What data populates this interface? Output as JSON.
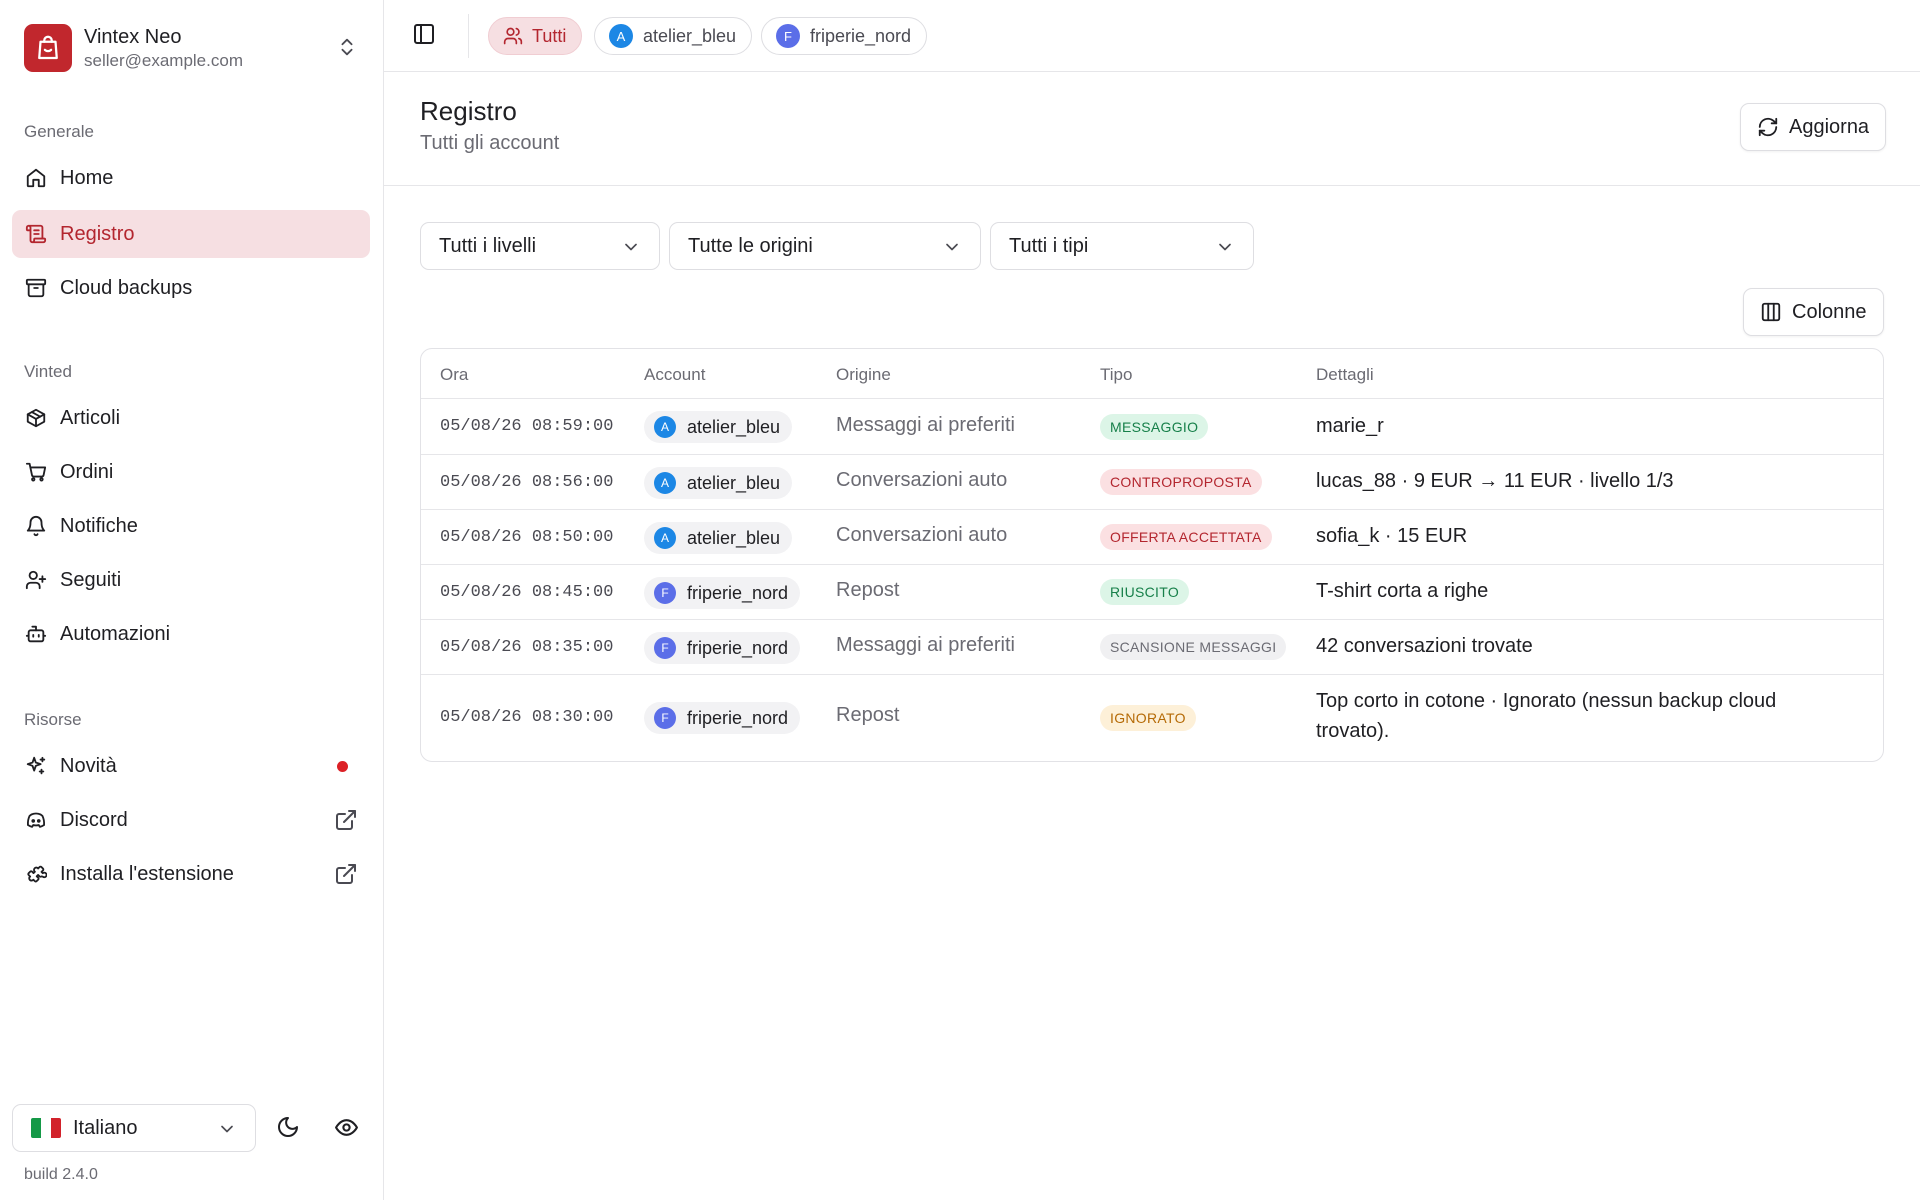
{
  "app": {
    "name": "Vintex Neo",
    "email": "seller@example.com",
    "build": "build 2.4.0"
  },
  "sidebar": {
    "sections": {
      "general": "Generale",
      "vinted": "Vinted",
      "resources": "Risorse"
    },
    "items": {
      "home": "Home",
      "registro": "Registro",
      "cloud_backups": "Cloud backups",
      "articoli": "Articoli",
      "ordini": "Ordini",
      "notifiche": "Notifiche",
      "seguiti": "Seguiti",
      "automazioni": "Automazioni",
      "novita": "Novità",
      "discord": "Discord",
      "estensione": "Installa l'estensione"
    },
    "active_item": "registro",
    "language": "Italiano"
  },
  "topbar": {
    "chips": [
      {
        "label": "Tutti",
        "active": true
      },
      {
        "label": "atelier_bleu",
        "avatar": "A",
        "active": false
      },
      {
        "label": "friperie_nord",
        "avatar": "F",
        "active": false
      }
    ]
  },
  "page": {
    "title": "Registro",
    "subtitle": "Tutti gli account",
    "refresh_label": "Aggiorna",
    "columns_label": "Colonne"
  },
  "filters": {
    "levels": "Tutti i livelli",
    "origins": "Tutte le origini",
    "types": "Tutti i tipi"
  },
  "table": {
    "headers": {
      "time": "Ora",
      "account": "Account",
      "origin": "Origine",
      "type": "Tipo",
      "details": "Dettagli"
    },
    "rows": [
      {
        "time": "05/08/26 08:59:00",
        "avatar": "A",
        "account": "atelier_bleu",
        "origin": "Messaggi ai preferiti",
        "type": "MESSAGGIO",
        "details": "marie_r"
      },
      {
        "time": "05/08/26 08:56:00",
        "avatar": "A",
        "account": "atelier_bleu",
        "origin": "Conversazioni auto",
        "type": "CONTROPROPOSTA",
        "details": "lucas_88 · 9 EUR → 11 EUR · livello 1/3"
      },
      {
        "time": "05/08/26 08:50:00",
        "avatar": "A",
        "account": "atelier_bleu",
        "origin": "Conversazioni auto",
        "type": "OFFERTA ACCETTATA",
        "details": "sofia_k · 15 EUR"
      },
      {
        "time": "05/08/26 08:45:00",
        "avatar": "F",
        "account": "friperie_nord",
        "origin": "Repost",
        "type": "RIUSCITO",
        "details": "T-shirt corta a righe"
      },
      {
        "time": "05/08/26 08:35:00",
        "avatar": "F",
        "account": "friperie_nord",
        "origin": "Messaggi ai preferiti",
        "type": "SCANSIONE MESSAGGI",
        "details": "42 conversazioni trovate"
      },
      {
        "time": "05/08/26 08:30:00",
        "avatar": "F",
        "account": "friperie_nord",
        "origin": "Repost",
        "type": "IGNORATO",
        "details": "Top corto in cotone · Ignorato (nessun backup cloud trovato)."
      }
    ]
  },
  "colors": {
    "brand": "#c1272d",
    "active_bg": "#f6dfe2",
    "avatar_a": "#1c87e5",
    "avatar_f": "#5b6ee8"
  }
}
